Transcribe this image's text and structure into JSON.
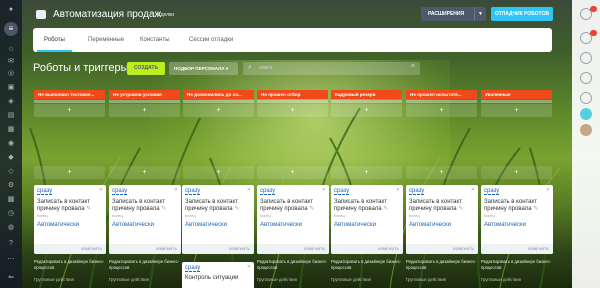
{
  "header": {
    "title": "Автоматизация продаж",
    "star_label": "Сделки"
  },
  "actions": {
    "extensions_label": "РАСШИРЕНИЯ",
    "debug_label": "ОТЛАДЧИК РОБОТОВ"
  },
  "tabs": [
    {
      "label": "Роботы"
    },
    {
      "label": "Переменные"
    },
    {
      "label": "Константы"
    },
    {
      "label": "Сессии отладки"
    }
  ],
  "toolbar": {
    "title": "Роботы и триггеры",
    "create_label": "СОЗДАТЬ",
    "pick_label": "ПОДБОР ПЕРСОНАЛА",
    "search_placeholder": "поиск"
  },
  "columns": [
    {
      "title": "Не выполнил тестовое...",
      "card": {
        "when": "сразу",
        "name": "Записать в контакт причину провала",
        "sub": "Конец",
        "mode": "Автоматически",
        "edit": "ИЗМЕНИТЬ"
      },
      "note": "Редактировать в дизайнере бизнес-процессов",
      "group": "Групповые действия"
    },
    {
      "title": "Не устроили условия",
      "card": {
        "when": "сразу",
        "name": "Записать в контакт причину провала",
        "sub": "Конец",
        "mode": "Автоматически",
        "edit": "ИЗМЕНИТЬ"
      },
      "note": "Редактировать в дизайнере бизнес-процессов",
      "group": "Групповые действия"
    },
    {
      "title": "Не дозвонились до со...",
      "card": {
        "when": "сразу",
        "name": "Записать в контакт причину провала",
        "sub": "Конец",
        "mode": "Автоматически",
        "edit": "ИЗМЕНИТЬ"
      },
      "note": "",
      "group": ""
    },
    {
      "title": "Не прошел отбор",
      "card": {
        "when": "сразу",
        "name": "Записать в контакт причину провала",
        "sub": "Конец",
        "mode": "Автоматически",
        "edit": "ИЗМЕНИТЬ"
      },
      "note": "Редактировать в дизайнере бизнес-процессов",
      "group": "Групповые действия"
    },
    {
      "title": "Кадровый резерв",
      "card": {
        "when": "сразу",
        "name": "Записать в контакт причину провала",
        "sub": "Конец",
        "mode": "Автоматически",
        "edit": "ИЗМЕНИТЬ"
      },
      "note": "Редактировать в дизайнере бизнес-процессов",
      "group": "Групповые действия"
    },
    {
      "title": "Не прошел испытате...",
      "card": {
        "when": "сразу",
        "name": "Записать в контакт причину провала",
        "sub": "Конец",
        "mode": "Автоматически",
        "edit": "ИЗМЕНИТЬ"
      },
      "note": "Редактировать в дизайнере бизнес-процессов",
      "group": "Групповые действия"
    },
    {
      "title": "Уволенные",
      "card": {
        "when": "сразу",
        "name": "Записать в контакт причину провала",
        "sub": "Конец",
        "mode": "Автоматически",
        "edit": "ИЗМЕНИТЬ"
      },
      "note": "Редактировать в дизайнере бизнес-процессов",
      "group": "Групповые действия"
    }
  ],
  "extra_card": {
    "when": "сразу",
    "name": "Контроль ситуации"
  },
  "colors": {
    "status": "#f14a1a",
    "accent": "#2fc6f6",
    "create": "#bbed21"
  }
}
